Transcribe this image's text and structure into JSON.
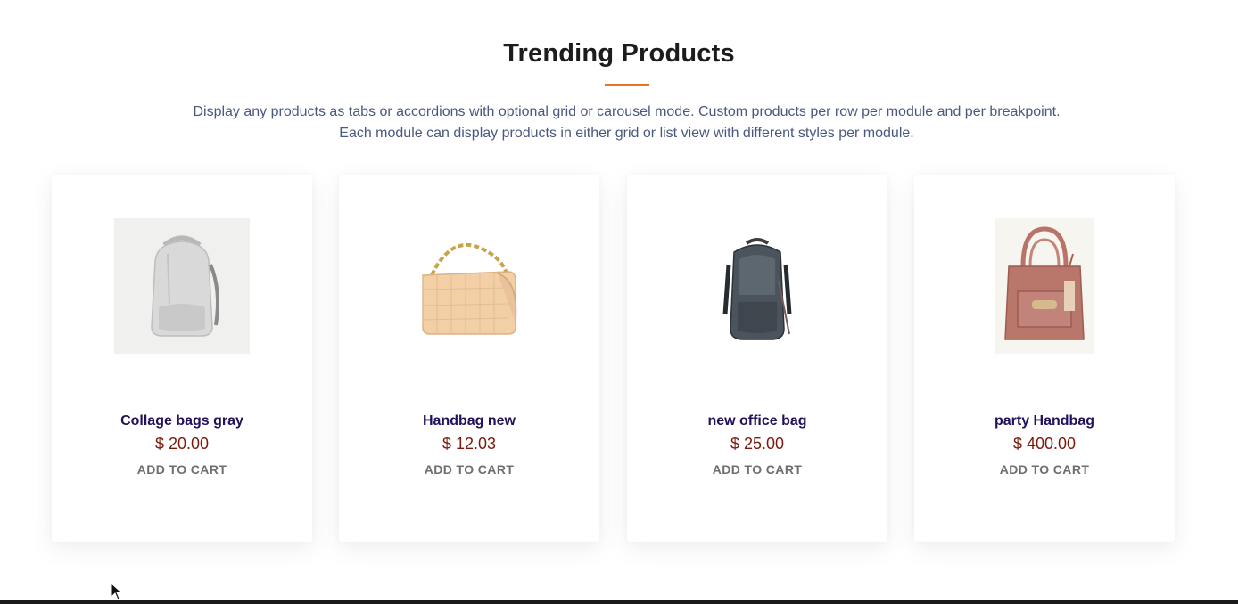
{
  "section": {
    "title": "Trending Products",
    "description_line1": "Display any products as tabs or accordions with optional grid or carousel mode. Custom products per row per module and per breakpoint.",
    "description_line2": "Each module can display products in either grid or list view with different styles per module."
  },
  "colors": {
    "accent": "#e8761f",
    "product_name": "#22115a",
    "price": "#7a1a0c",
    "description": "#4a5880"
  },
  "products": [
    {
      "name": "Collage bags gray",
      "price": "$ 20.00",
      "cart_label": "ADD TO CART",
      "image_icon": "gray-backpack-icon"
    },
    {
      "name": "Handbag new",
      "price": "$ 12.03",
      "cart_label": "ADD TO CART",
      "image_icon": "beige-quilted-handbag-icon"
    },
    {
      "name": "new office bag",
      "price": "$ 25.00",
      "cart_label": "ADD TO CART",
      "image_icon": "dark-office-backpack-icon"
    },
    {
      "name": "party Handbag",
      "price": "$ 400.00",
      "cart_label": "ADD TO CART",
      "image_icon": "pink-tote-handbag-icon"
    }
  ]
}
